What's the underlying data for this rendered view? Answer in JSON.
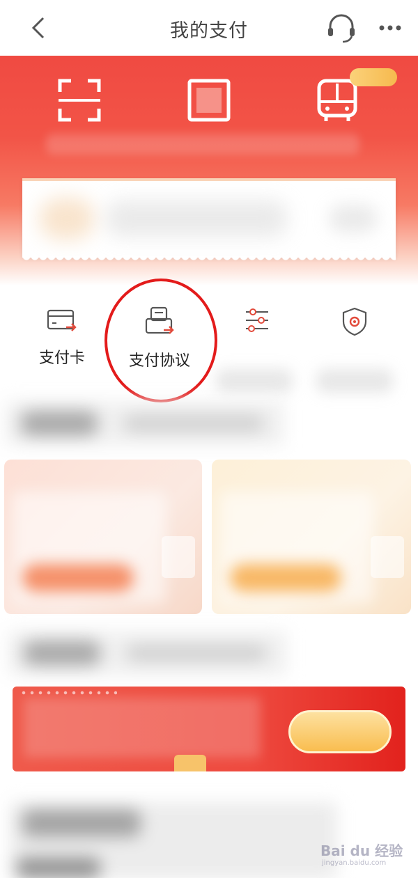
{
  "header": {
    "title": "我的支付",
    "back_icon": "chevron-left-icon",
    "service_icon": "headset-icon",
    "more_icon": "more-dots-icon"
  },
  "banner": {
    "quick_actions": [
      {
        "icon": "scan-icon"
      },
      {
        "icon": "payment-code-icon"
      },
      {
        "icon": "bus-icon"
      }
    ],
    "accent_color": "#f04a42"
  },
  "menu": {
    "items": [
      {
        "label": "支付卡",
        "icon": "bank-card-icon"
      },
      {
        "label": "支付协议",
        "icon": "agreement-icon"
      },
      {
        "label": "",
        "icon": "settings-sliders-icon"
      },
      {
        "label": "",
        "icon": "security-shield-icon"
      }
    ],
    "icon_color": "#e24a3b",
    "highlight_color": "#e31b1b"
  },
  "watermark": {
    "text": "Bai du 经验",
    "sub": "jingyan.baidu.com"
  }
}
